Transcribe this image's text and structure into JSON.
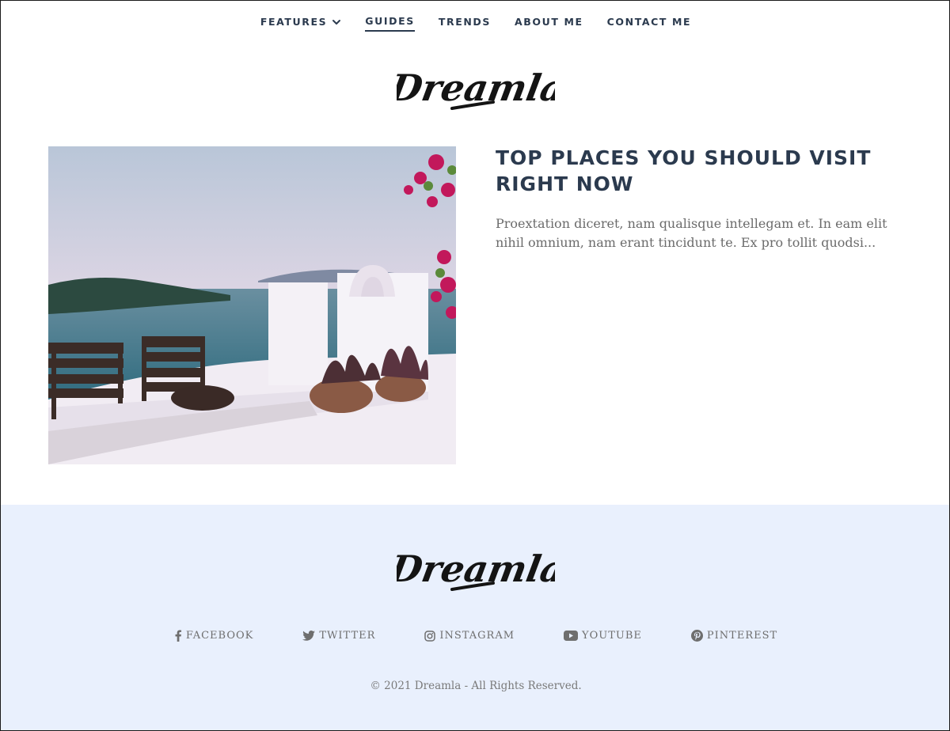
{
  "nav": {
    "items": [
      {
        "label": "FEATURES",
        "has_dropdown": true,
        "active": false
      },
      {
        "label": "GUIDES",
        "has_dropdown": false,
        "active": true
      },
      {
        "label": "TRENDS",
        "has_dropdown": false,
        "active": false
      },
      {
        "label": "ABOUT ME",
        "has_dropdown": false,
        "active": false
      },
      {
        "label": "CONTACT ME",
        "has_dropdown": false,
        "active": false
      }
    ]
  },
  "brand": {
    "logo_text": "Dreamla",
    "text_color": "#2b3a4e",
    "footer_bg": "#e9f0fd"
  },
  "post": {
    "title": "TOP PLACES YOU SHOULD VISIT RIGHT NOW",
    "excerpt": "Proextation diceret, nam qualisque intellegam et. In eam elit nihil omnium, nam erant tincidunt te. Ex pro tollit quodsi...",
    "image_icon": "santorini-terrace-photo"
  },
  "footer": {
    "social": [
      {
        "label": "FACEBOOK",
        "icon": "facebook-icon"
      },
      {
        "label": "TWITTER",
        "icon": "twitter-icon"
      },
      {
        "label": "INSTAGRAM",
        "icon": "instagram-icon"
      },
      {
        "label": "YOUTUBE",
        "icon": "youtube-icon"
      },
      {
        "label": "PINTEREST",
        "icon": "pinterest-icon"
      }
    ],
    "copyright": "© 2021 Dreamla - All Rights Reserved."
  }
}
